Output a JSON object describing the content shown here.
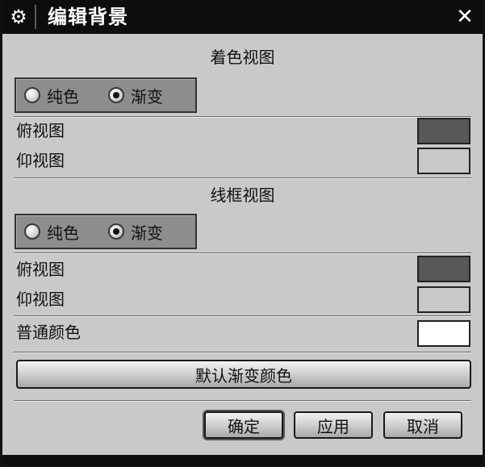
{
  "dialog": {
    "title": "编辑背景",
    "title_icon": "gear-icon",
    "close_icon": "close-icon",
    "close_glyph": "✕"
  },
  "shaded_view": {
    "heading": "着色视图",
    "mode_options": [
      "纯色",
      "渐变"
    ],
    "selected_mode": "渐变",
    "top_label": "俯视图",
    "top_color": "#585858",
    "bottom_label": "仰视图",
    "bottom_color": "#c8c8c8"
  },
  "wireframe_view": {
    "heading": "线框视图",
    "mode_options": [
      "纯色",
      "渐变"
    ],
    "selected_mode": "渐变",
    "top_label": "俯视图",
    "top_color": "#585858",
    "bottom_label": "仰视图",
    "bottom_color": "#c8c8c8"
  },
  "plain_color": {
    "label": "普通颜色",
    "color": "#ffffff"
  },
  "default_gradient_button": "默认渐变颜色",
  "buttons": {
    "ok": "确定",
    "apply": "应用",
    "cancel": "取消"
  }
}
